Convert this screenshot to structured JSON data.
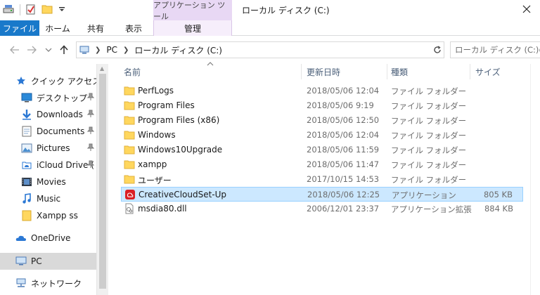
{
  "window": {
    "title": "ローカル ディスク (C:)",
    "context_tab_title": "アプリケーション ツール"
  },
  "ribbon": {
    "tabs": [
      {
        "label": "ファイル"
      },
      {
        "label": "ホーム"
      },
      {
        "label": "共有"
      },
      {
        "label": "表示"
      },
      {
        "label": "管理"
      }
    ]
  },
  "address": {
    "crumbs": [
      "PC",
      "ローカル ディスク (C:)"
    ],
    "search_placeholder": "ローカル ディスク (C:)の検索"
  },
  "nav": {
    "items": [
      {
        "label": "クイック アクセス",
        "icon": "star-icon"
      },
      {
        "label": "デスクトップ",
        "icon": "desktop-icon",
        "pinned": true
      },
      {
        "label": "Downloads",
        "icon": "download-icon",
        "pinned": true
      },
      {
        "label": "Documents",
        "icon": "document-icon",
        "pinned": true
      },
      {
        "label": "Pictures",
        "icon": "pictures-icon",
        "pinned": true
      },
      {
        "label": "iCloud Drive (",
        "icon": "icloud-icon",
        "pinned": true
      },
      {
        "label": "Movies",
        "icon": "movies-icon"
      },
      {
        "label": "Music",
        "icon": "music-icon"
      },
      {
        "label": "Xampp ss",
        "icon": "folder-icon"
      },
      {
        "label": "OneDrive",
        "icon": "onedrive-icon"
      },
      {
        "label": "PC",
        "icon": "pc-icon"
      },
      {
        "label": "ネットワーク",
        "icon": "network-icon"
      }
    ]
  },
  "columns": {
    "name": "名前",
    "date": "更新日時",
    "type": "種類",
    "size": "サイズ"
  },
  "files": [
    {
      "name": "PerfLogs",
      "date": "2018/05/06 12:04",
      "type": "ファイル フォルダー",
      "size": "",
      "icon": "folder-icon"
    },
    {
      "name": "Program Files",
      "date": "2018/05/06 9:19",
      "type": "ファイル フォルダー",
      "size": "",
      "icon": "folder-icon"
    },
    {
      "name": "Program Files (x86)",
      "date": "2018/05/06 12:50",
      "type": "ファイル フォルダー",
      "size": "",
      "icon": "folder-icon"
    },
    {
      "name": "Windows",
      "date": "2018/05/06 12:04",
      "type": "ファイル フォルダー",
      "size": "",
      "icon": "folder-icon"
    },
    {
      "name": "Windows10Upgrade",
      "date": "2018/05/06 11:59",
      "type": "ファイル フォルダー",
      "size": "",
      "icon": "folder-icon"
    },
    {
      "name": "xampp",
      "date": "2018/05/06 11:47",
      "type": "ファイル フォルダー",
      "size": "",
      "icon": "folder-icon"
    },
    {
      "name": "ユーザー",
      "date": "2017/10/15 14:53",
      "type": "ファイル フォルダー",
      "size": "",
      "icon": "folder-icon"
    },
    {
      "name": "CreativeCloudSet-Up",
      "date": "2018/05/06 12:25",
      "type": "アプリケーション",
      "size": "805 KB",
      "icon": "creative-cloud-icon"
    },
    {
      "name": "msdia80.dll",
      "date": "2006/12/01 23:37",
      "type": "アプリケーション拡張",
      "size": "884 KB",
      "icon": "dll-file-icon"
    }
  ],
  "colors": {
    "file_tab": "#1979ca",
    "context_tab": "#e8d8f4",
    "selection": "#cce8ff",
    "folder": "#ffd75e"
  }
}
